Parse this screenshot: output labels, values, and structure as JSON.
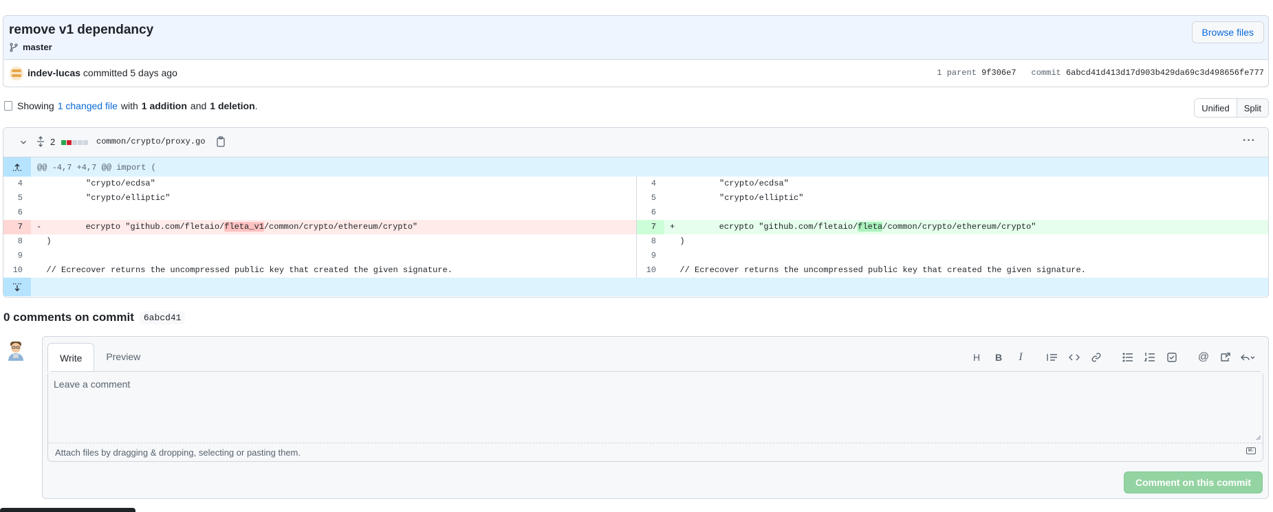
{
  "commit": {
    "title": "remove v1 dependancy",
    "branch": "master",
    "browse_label": "Browse files",
    "author": "indev-lucas",
    "committed_text": "committed 5 days ago",
    "parent_label": "1 parent",
    "parent_sha": "9f306e7",
    "commit_label": "commit",
    "commit_sha": "6abcd41d413d17d903b429da69c3d498656fe777"
  },
  "summary": {
    "showing": "Showing",
    "changed": "1 changed file",
    "with": "with",
    "additions": "1 addition",
    "and": "and",
    "deletions": "1 deletion",
    "period": "."
  },
  "view_toggle": {
    "unified": "Unified",
    "split": "Split",
    "active": "split"
  },
  "diff": {
    "count": "2",
    "path": "common/crypto/proxy.go",
    "hunk": "@@ -4,7 +4,7 @@ import (",
    "colors": {
      "add": "#2da44e",
      "del": "#cf222e",
      "neutral": "#d0d7de"
    },
    "left": [
      {
        "ln": "4",
        "text": "\t\"crypto/ecdsa\""
      },
      {
        "ln": "5",
        "text": "\t\"crypto/elliptic\""
      },
      {
        "ln": "6",
        "text": ""
      },
      {
        "ln": "7",
        "marker": "-",
        "pre": "\tecrypto \"github.com/fletaio/",
        "hl": "fleta_v1",
        "post": "/common/crypto/ethereum/crypto\""
      },
      {
        "ln": "8",
        "text": ")"
      },
      {
        "ln": "9",
        "text": ""
      },
      {
        "ln": "10",
        "text": "// Ecrecover returns the uncompressed public key that created the given signature."
      }
    ],
    "right": [
      {
        "ln": "4",
        "text": "\t\"crypto/ecdsa\""
      },
      {
        "ln": "5",
        "text": "\t\"crypto/elliptic\""
      },
      {
        "ln": "6",
        "text": ""
      },
      {
        "ln": "7",
        "marker": "+",
        "pre": "\tecrypto \"github.com/fletaio/",
        "hl": "fleta",
        "post": "/common/crypto/ethereum/crypto\""
      },
      {
        "ln": "8",
        "text": ")"
      },
      {
        "ln": "9",
        "text": ""
      },
      {
        "ln": "10",
        "text": "// Ecrecover returns the uncompressed public key that created the given signature."
      }
    ]
  },
  "comments": {
    "title": "0 comments on commit",
    "sha": "6abcd41",
    "tab_write": "Write",
    "tab_preview": "Preview",
    "placeholder": "Leave a comment",
    "attach_text": "Attach files by dragging & dropping, selecting or pasting them.",
    "submit": "Comment on this commit"
  }
}
